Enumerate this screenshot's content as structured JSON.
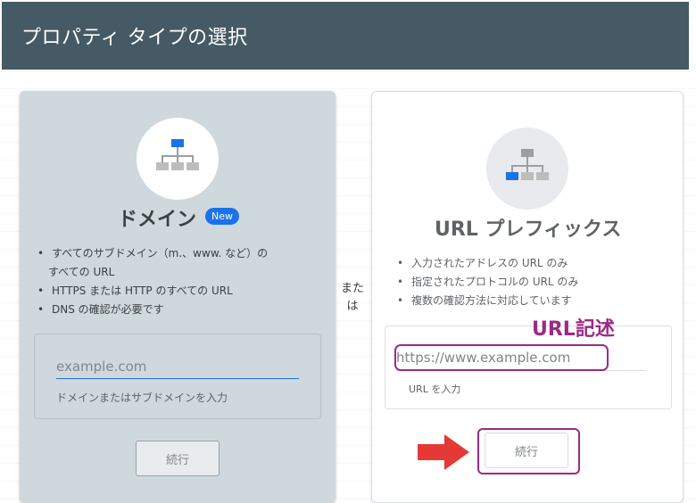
{
  "header": {
    "title": "プロパティ タイプの選択"
  },
  "domain_card": {
    "title": "ドメイン",
    "badge": "New",
    "features": [
      "すべてのサブドメイン（m.、www. など）の",
      "すべての URL",
      "HTTPS または HTTP のすべての URL",
      "DNS の確認が必要です"
    ],
    "input": {
      "value": "",
      "placeholder": "example.com"
    },
    "helper": "ドメインまたはサブドメインを入力",
    "continue_label": "続行"
  },
  "or_text": {
    "line1": "また",
    "line2": "は"
  },
  "url_card": {
    "title": "URL プレフィックス",
    "features": [
      "入力されたアドレスの URL のみ",
      "指定されたプロトコルの URL のみ",
      "複数の確認方法に対応しています"
    ],
    "input": {
      "value": "",
      "placeholder": "https://www.example.com"
    },
    "helper": "URL を入力",
    "continue_label": "続行"
  },
  "annotation": {
    "label": "URL記述"
  },
  "colors": {
    "header_bg": "#455a64",
    "domain_card_bg": "#cfd8dc",
    "accent_blue": "#1a73e8",
    "annotation": "#9c2a84",
    "arrow": "#e53935"
  },
  "icons": {
    "domain": "sitemap-icon",
    "url_prefix": "sitemap-icon",
    "arrow": "arrow-right-icon"
  }
}
